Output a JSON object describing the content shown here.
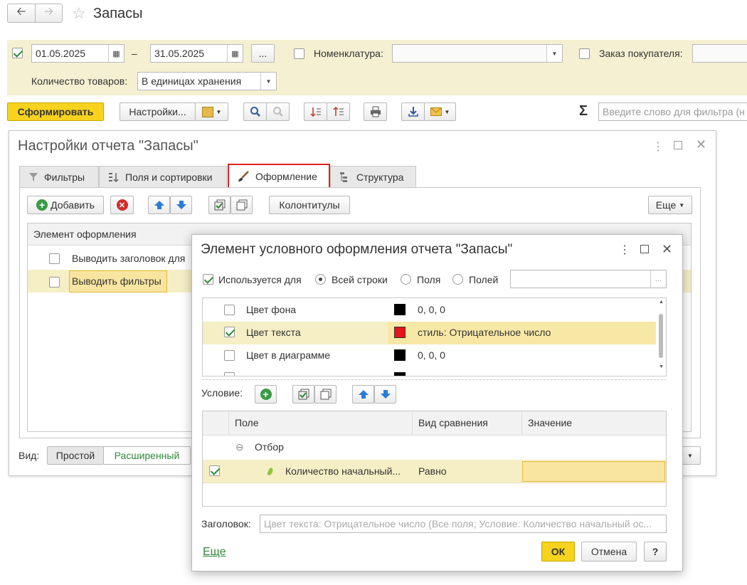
{
  "header": {
    "title": "Запасы"
  },
  "filters": {
    "date_from": "01.05.2025",
    "date_dash": "–",
    "date_to": "31.05.2025",
    "ellipsis": "...",
    "nomenclature_label": "Номенклатура:",
    "customer_order_label": "Заказ покупателя:",
    "quantity_label": "Количество товаров:",
    "quantity_value": "В единицах хранения"
  },
  "toolbar": {
    "generate": "Сформировать",
    "settings": "Настройки...",
    "search_placeholder": "Введите слово для фильтра (н"
  },
  "settings_window": {
    "title": "Настройки отчета \"Запасы\"",
    "tabs": [
      {
        "label": "Фильтры"
      },
      {
        "label": "Поля и сортировки"
      },
      {
        "label": "Оформление"
      },
      {
        "label": "Структура"
      }
    ],
    "add": "Добавить",
    "headers_footers": "Колонтитулы",
    "more": "Еще",
    "column_header": "Элемент оформления",
    "rows": [
      "Выводить заголовок для",
      "Выводить фильтры"
    ],
    "view_label": "Вид:",
    "view_simple": "Простой",
    "view_extended": "Расширенный"
  },
  "dialog": {
    "title": "Элемент условного оформления отчета \"Запасы\"",
    "used_for_label": "Используется для",
    "radio_all_rows": "Всей строки",
    "radio_fields": "Поля",
    "radio_fields2": "Полей",
    "ellipsis": "...",
    "props": [
      {
        "name": "Цвет фона",
        "value": "0, 0, 0",
        "color": "#000000",
        "checked": false
      },
      {
        "name": "Цвет текста",
        "value": "стиль: Отрицательное число",
        "color": "#e8141c",
        "checked": true
      },
      {
        "name": "Цвет в диаграмме",
        "value": "0, 0, 0",
        "color": "#000000",
        "checked": false
      }
    ],
    "condition_label": "Условие:",
    "cond_headers": {
      "field": "Поле",
      "compare": "Вид сравнения",
      "value": "Значение"
    },
    "group_label": "Отбор",
    "cond_field": "Количество начальный...",
    "cond_compare": "Равно",
    "cond_value": "",
    "caption_label": "Заголовок:",
    "caption_placeholder": "Цвет текста: Отрицательное число (Все поля; Условие: Количество начальный ос...",
    "more_link": "Еще",
    "ok": "ОК",
    "cancel": "Отмена",
    "help": "?"
  },
  "colors": {
    "accent_yellow": "#f7d21f",
    "panel_yellow": "#f5f0d2",
    "highlight_tab": "#e0221f",
    "selected_row": "#f8e8a6"
  }
}
